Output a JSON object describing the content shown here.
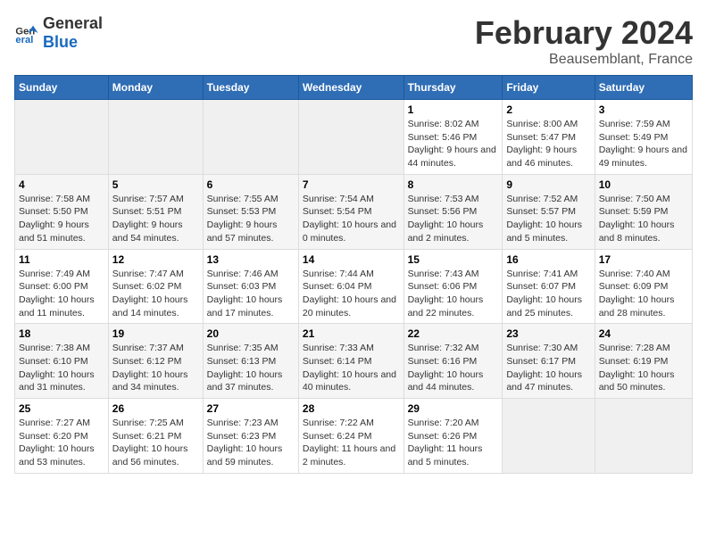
{
  "header": {
    "logo": {
      "text_general": "General",
      "text_blue": "Blue"
    },
    "title": "February 2024",
    "subtitle": "Beausemblant, France"
  },
  "days_of_week": [
    "Sunday",
    "Monday",
    "Tuesday",
    "Wednesday",
    "Thursday",
    "Friday",
    "Saturday"
  ],
  "weeks": [
    {
      "cells": [
        {
          "empty": true
        },
        {
          "empty": true
        },
        {
          "empty": true
        },
        {
          "empty": true
        },
        {
          "day": 1,
          "sunrise": "8:02 AM",
          "sunset": "5:46 PM",
          "daylight": "9 hours and 44 minutes."
        },
        {
          "day": 2,
          "sunrise": "8:00 AM",
          "sunset": "5:47 PM",
          "daylight": "9 hours and 46 minutes."
        },
        {
          "day": 3,
          "sunrise": "7:59 AM",
          "sunset": "5:49 PM",
          "daylight": "9 hours and 49 minutes."
        }
      ]
    },
    {
      "cells": [
        {
          "day": 4,
          "sunrise": "7:58 AM",
          "sunset": "5:50 PM",
          "daylight": "9 hours and 51 minutes."
        },
        {
          "day": 5,
          "sunrise": "7:57 AM",
          "sunset": "5:51 PM",
          "daylight": "9 hours and 54 minutes."
        },
        {
          "day": 6,
          "sunrise": "7:55 AM",
          "sunset": "5:53 PM",
          "daylight": "9 hours and 57 minutes."
        },
        {
          "day": 7,
          "sunrise": "7:54 AM",
          "sunset": "5:54 PM",
          "daylight": "10 hours and 0 minutes."
        },
        {
          "day": 8,
          "sunrise": "7:53 AM",
          "sunset": "5:56 PM",
          "daylight": "10 hours and 2 minutes."
        },
        {
          "day": 9,
          "sunrise": "7:52 AM",
          "sunset": "5:57 PM",
          "daylight": "10 hours and 5 minutes."
        },
        {
          "day": 10,
          "sunrise": "7:50 AM",
          "sunset": "5:59 PM",
          "daylight": "10 hours and 8 minutes."
        }
      ]
    },
    {
      "cells": [
        {
          "day": 11,
          "sunrise": "7:49 AM",
          "sunset": "6:00 PM",
          "daylight": "10 hours and 11 minutes."
        },
        {
          "day": 12,
          "sunrise": "7:47 AM",
          "sunset": "6:02 PM",
          "daylight": "10 hours and 14 minutes."
        },
        {
          "day": 13,
          "sunrise": "7:46 AM",
          "sunset": "6:03 PM",
          "daylight": "10 hours and 17 minutes."
        },
        {
          "day": 14,
          "sunrise": "7:44 AM",
          "sunset": "6:04 PM",
          "daylight": "10 hours and 20 minutes."
        },
        {
          "day": 15,
          "sunrise": "7:43 AM",
          "sunset": "6:06 PM",
          "daylight": "10 hours and 22 minutes."
        },
        {
          "day": 16,
          "sunrise": "7:41 AM",
          "sunset": "6:07 PM",
          "daylight": "10 hours and 25 minutes."
        },
        {
          "day": 17,
          "sunrise": "7:40 AM",
          "sunset": "6:09 PM",
          "daylight": "10 hours and 28 minutes."
        }
      ]
    },
    {
      "cells": [
        {
          "day": 18,
          "sunrise": "7:38 AM",
          "sunset": "6:10 PM",
          "daylight": "10 hours and 31 minutes."
        },
        {
          "day": 19,
          "sunrise": "7:37 AM",
          "sunset": "6:12 PM",
          "daylight": "10 hours and 34 minutes."
        },
        {
          "day": 20,
          "sunrise": "7:35 AM",
          "sunset": "6:13 PM",
          "daylight": "10 hours and 37 minutes."
        },
        {
          "day": 21,
          "sunrise": "7:33 AM",
          "sunset": "6:14 PM",
          "daylight": "10 hours and 40 minutes."
        },
        {
          "day": 22,
          "sunrise": "7:32 AM",
          "sunset": "6:16 PM",
          "daylight": "10 hours and 44 minutes."
        },
        {
          "day": 23,
          "sunrise": "7:30 AM",
          "sunset": "6:17 PM",
          "daylight": "10 hours and 47 minutes."
        },
        {
          "day": 24,
          "sunrise": "7:28 AM",
          "sunset": "6:19 PM",
          "daylight": "10 hours and 50 minutes."
        }
      ]
    },
    {
      "cells": [
        {
          "day": 25,
          "sunrise": "7:27 AM",
          "sunset": "6:20 PM",
          "daylight": "10 hours and 53 minutes."
        },
        {
          "day": 26,
          "sunrise": "7:25 AM",
          "sunset": "6:21 PM",
          "daylight": "10 hours and 56 minutes."
        },
        {
          "day": 27,
          "sunrise": "7:23 AM",
          "sunset": "6:23 PM",
          "daylight": "10 hours and 59 minutes."
        },
        {
          "day": 28,
          "sunrise": "7:22 AM",
          "sunset": "6:24 PM",
          "daylight": "11 hours and 2 minutes."
        },
        {
          "day": 29,
          "sunrise": "7:20 AM",
          "sunset": "6:26 PM",
          "daylight": "11 hours and 5 minutes."
        },
        {
          "empty": true
        },
        {
          "empty": true
        }
      ]
    }
  ],
  "labels": {
    "sunrise": "Sunrise:",
    "sunset": "Sunset:",
    "daylight": "Daylight:"
  }
}
